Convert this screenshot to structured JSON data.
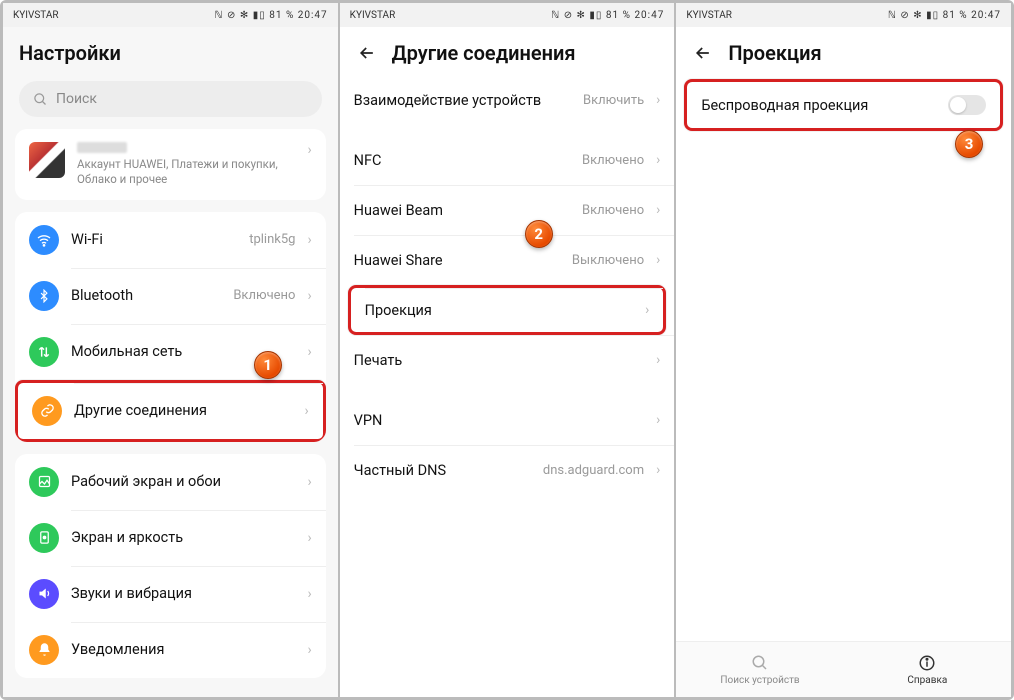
{
  "statusbar": {
    "carrier": "KYIVSTAR",
    "battery": "81 %",
    "time": "20:47",
    "icons": "ℕ ⊘ ✻ ▮▯"
  },
  "panel1": {
    "title": "Настройки",
    "search_placeholder": "Поиск",
    "account_sub": "Аккаунт HUAWEI, Платежи и покупки, Облако и прочее",
    "items": {
      "wifi": {
        "label": "Wi-Fi",
        "value": "tplink5g"
      },
      "bluetooth": {
        "label": "Bluetooth",
        "value": "Включено"
      },
      "mobile": {
        "label": "Мобильная сеть",
        "value": ""
      },
      "other_conn": {
        "label": "Другие соединения",
        "value": ""
      },
      "home": {
        "label": "Рабочий экран и обои",
        "value": ""
      },
      "display": {
        "label": "Экран и яркость",
        "value": ""
      },
      "sound": {
        "label": "Звуки и вибрация",
        "value": ""
      },
      "notif": {
        "label": "Уведомления",
        "value": ""
      }
    },
    "badge": "1"
  },
  "panel2": {
    "title": "Другие соединения",
    "items": {
      "devint": {
        "label": "Взаимодействие устройств",
        "value": "Включить"
      },
      "nfc": {
        "label": "NFC",
        "value": "Включено"
      },
      "beam": {
        "label": "Huawei Beam",
        "value": "Включено"
      },
      "share": {
        "label": "Huawei Share",
        "value": "Выключено"
      },
      "proj": {
        "label": "Проекция",
        "value": ""
      },
      "print": {
        "label": "Печать",
        "value": ""
      },
      "vpn": {
        "label": "VPN",
        "value": ""
      },
      "dns": {
        "label": "Частный DNS",
        "value": "dns.adguard.com"
      }
    },
    "badge": "2"
  },
  "panel3": {
    "title": "Проекция",
    "wireless_label": "Беспроводная проекция",
    "badge": "3",
    "nav": {
      "search": "Поиск устройств",
      "help": "Справка"
    }
  },
  "colors": {
    "wifi": "#2d8cff",
    "bt": "#2d8cff",
    "mobile": "#2ec95b",
    "link": "#ff9a1f",
    "home": "#2ec95b",
    "display": "#2ec95b",
    "sound": "#5b4cff",
    "notif": "#ff9a1f"
  }
}
